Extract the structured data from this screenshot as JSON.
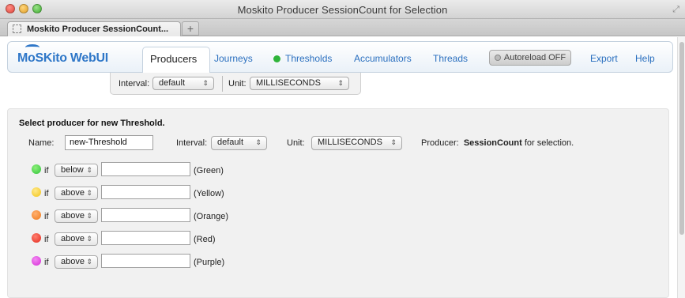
{
  "window": {
    "title": "Moskito Producer SessionCount for Selection",
    "tab_label": "Moskito Producer SessionCount...",
    "new_tab_symbol": "+"
  },
  "header": {
    "logo": "MoSKito WebUI",
    "nav": [
      "Producers",
      "Journeys",
      "Thresholds",
      "Accumulators",
      "Threads"
    ],
    "active_nav": "Producers",
    "thresholds_status_color": "#2fb43a",
    "autoreload": "Autoreload OFF",
    "export": "Export",
    "help": "Help"
  },
  "filter": {
    "interval_label": "Interval:",
    "interval_value": "default",
    "unit_label": "Unit:",
    "unit_value": "MILLISECONDS"
  },
  "form": {
    "title": "Select producer for new Threshold.",
    "name_label": "Name:",
    "name_value": "new-Threshold",
    "interval_label": "Interval:",
    "interval_value": "default",
    "unit_label": "Unit:",
    "unit_value": "MILLISECONDS",
    "producer_label": "Producer:",
    "producer_name": "SessionCount",
    "producer_suffix": " for selection.",
    "conditions": [
      {
        "color": "#2fc33a",
        "if_label": "if",
        "operator": "below",
        "value": "",
        "status": "(Green)"
      },
      {
        "color": "#f2c416",
        "if_label": "if",
        "operator": "above",
        "value": "",
        "status": "(Yellow)"
      },
      {
        "color": "#f07a1a",
        "if_label": "if",
        "operator": "above",
        "value": "",
        "status": "(Orange)"
      },
      {
        "color": "#e32a1e",
        "if_label": "if",
        "operator": "above",
        "value": "",
        "status": "(Red)"
      },
      {
        "color": "#d62bd6",
        "if_label": "if",
        "operator": "above",
        "value": "",
        "status": "(Purple)"
      }
    ]
  }
}
